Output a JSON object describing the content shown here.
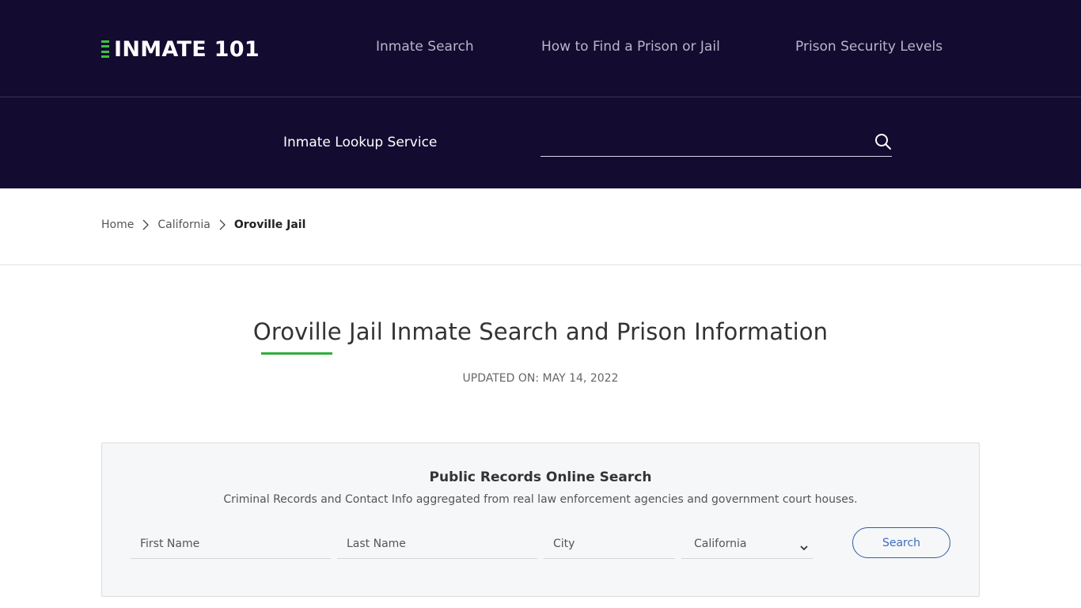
{
  "header": {
    "logo_text": "INMATE 101",
    "nav": [
      {
        "label": "Inmate Search"
      },
      {
        "label": "How to Find a Prison or Jail"
      },
      {
        "label": "Prison Security Levels"
      }
    ],
    "lookup_label": "Inmate Lookup Service",
    "lookup_search": {
      "value": "",
      "placeholder": "",
      "icon": "search-icon"
    }
  },
  "breadcrumb": {
    "items": [
      {
        "label": "Home"
      },
      {
        "label": "California"
      },
      {
        "label": "Oroville Jail"
      }
    ],
    "separator_icon": "chevron-right-icon"
  },
  "main": {
    "title": "Oroville Jail Inmate Search and Prison Information",
    "updated": "UPDATED ON: MAY 14, 2022"
  },
  "search_box": {
    "title": "Public Records Online Search",
    "subtitle": "Criminal Records and Contact Info aggregated from real law enforcement agencies and government court houses.",
    "fields": {
      "first_name": {
        "placeholder": "First Name",
        "value": ""
      },
      "last_name": {
        "placeholder": "Last Name",
        "value": ""
      },
      "city": {
        "placeholder": "City",
        "value": ""
      },
      "state": {
        "selected": "California"
      }
    },
    "button_label": "Search"
  },
  "colors": {
    "header_bg": "#130b30",
    "accent_green": "#2fae3a",
    "button_blue": "#2e5fa8"
  }
}
